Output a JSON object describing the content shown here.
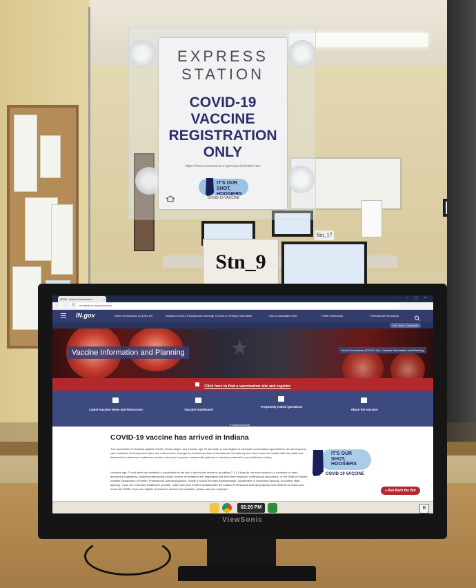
{
  "sign": {
    "heading": "EXPRESS STATION",
    "line1": "COVID-19",
    "line2": "VACCINE",
    "line3": "REGISTRATION",
    "line4": "ONLY",
    "url": "https://www.coronavirus.in.gov/vaccine/index.htm",
    "logo_line1": "IT'S OUR",
    "logo_line2": "SHOT,",
    "logo_line3": "HOOSIERS",
    "logo_sub": "COVID-19 VACCINE"
  },
  "station_card": "Stn_9",
  "station_back": "Stn_17",
  "monitor_brand": "ViewSonic",
  "browser": {
    "tab_title": "IDOH - Novel Coronavirus",
    "url": "coronavirus.in.gov/vaccine/"
  },
  "site": {
    "logo": "IN.gov",
    "nav": [
      "Novel Coronavirus (COVID-19)",
      "Indiana COVID-19 Dashboard and Map",
      "COVID-19 Testing Information",
      "Find a Vaccination Site",
      "Public Resources",
      "Professional Resources"
    ],
    "search_label": "SEARCH",
    "governor_button": "Gov. Eric J. Holcomb",
    "hero_title": "Vaccine Information and Planning",
    "breadcrumb": "Novel Coronavirus (COVID-19)  >  Vaccine Information and Planning",
    "red_bar_link": "Click here to find a vaccination site and register",
    "quick_links": [
      "Latest Vaccine News and Resources",
      "Vaccine Dashboard",
      "Frequently Asked Questions",
      "About the Vaccine"
    ],
    "scroll_button": "Scroll for more",
    "content_title": "COVID-19 vaccine has arrived in Indiana",
    "paragraph1": "The vaccination of Hoosiers against COVID-19 has begun. Any Hoosier age 70 and older is now eligible to schedule a vaccination appointment, as are long-term care residents, first responders (fire, law enforcement, emergency medical services, reservists and volunteers) who have in-person contact with the public and licensed and unlicensed healthcare workers who have in-person contact with patients or infectious material in any healthcare setting.",
    "paragraph2": "Hoosiers age 70 and older can schedule a vaccination at the link in the red bar above or by calling 2-1-1 if they do not have access to a computer or need assistance registering. Eligible professionals should receive an invitation and registration link from their employer, professional association, or the State of Indiana (Indiana Department of Health, Professional Licensing Agency, Family & Social Services Administration, Department of Homeland Security, or another state agency). If you are a licensed healthcare provider, make sure your email is updated with the Indiana Professional Licensing Agency and continue to check your email and SPAM. If you are eligible and haven't received an invitation, please ask your employer.",
    "logo_line1": "IT'S OUR",
    "logo_line2": "SHOT,",
    "logo_line3": "HOOSIERS",
    "logo_sub": "COVID-19 VACCINE",
    "bot_button": "Ask Barb the Bot"
  },
  "taskbar": {
    "clock": "02:20 PM",
    "keyboard": "R"
  },
  "colors": {
    "gov_nav": "#323d6b",
    "red_bar": "#b3282d",
    "quick_links": "#3c4a80",
    "sign_text": "#2b2f66"
  }
}
